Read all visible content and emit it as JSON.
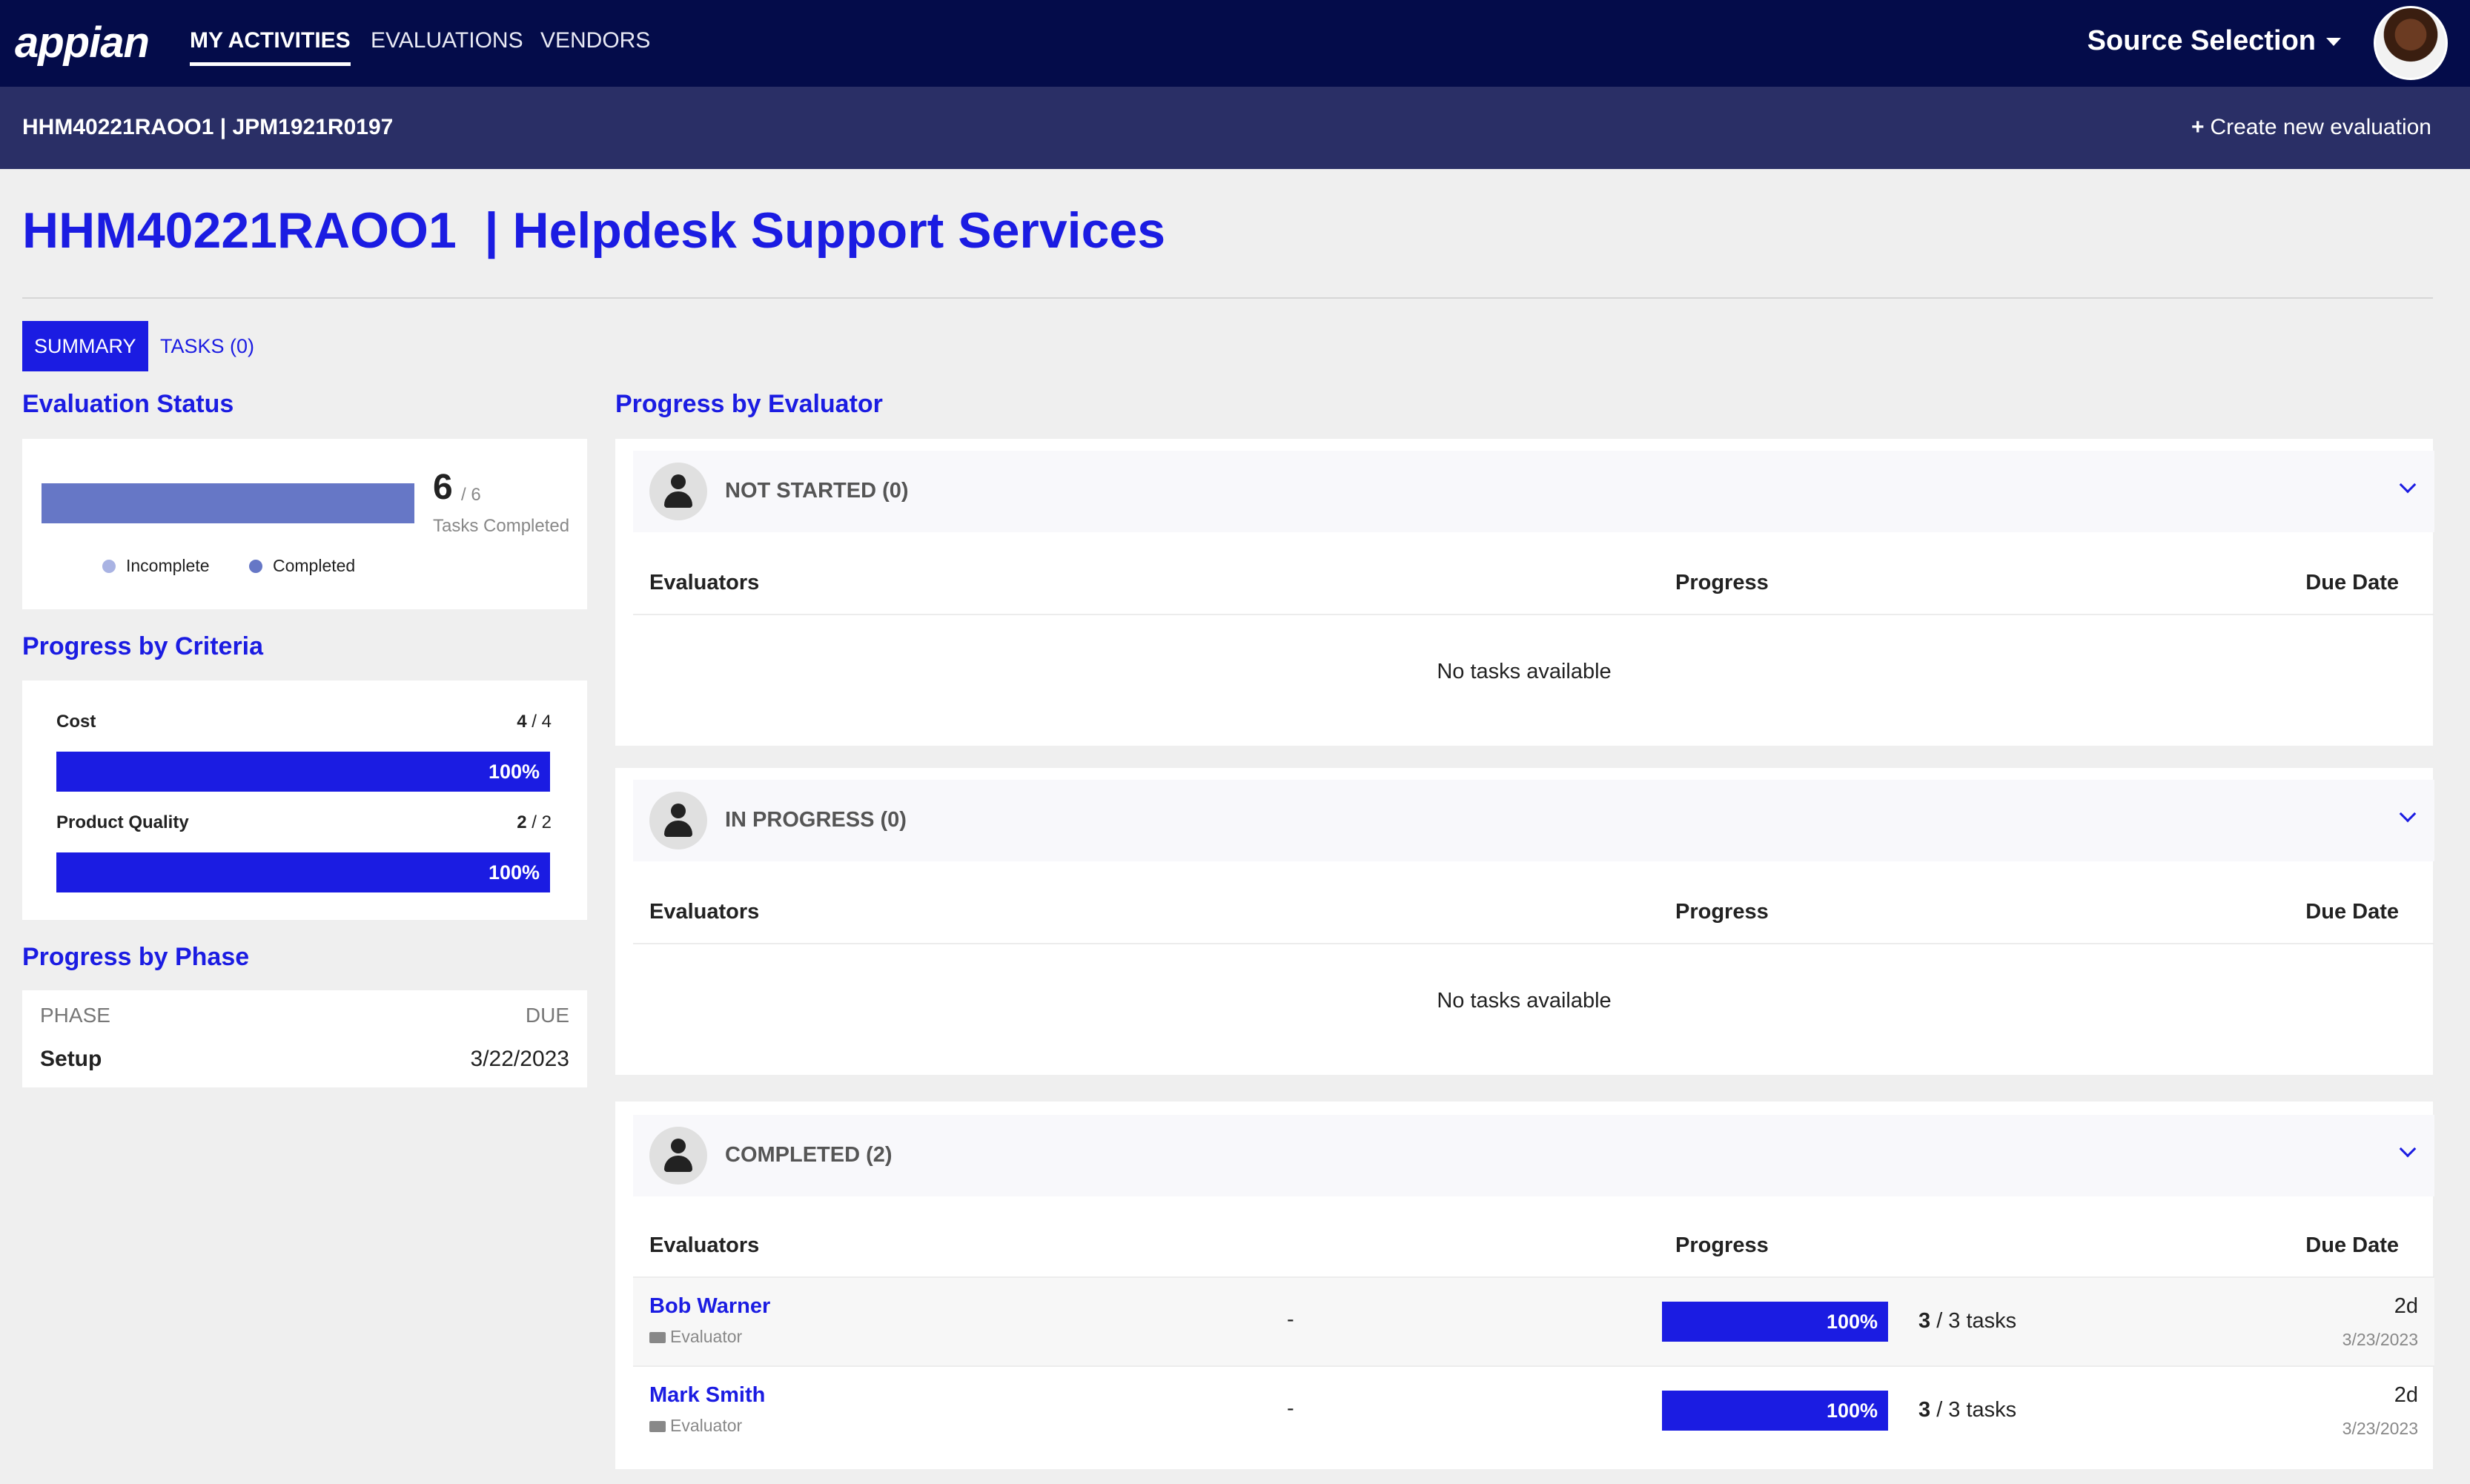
{
  "nav": {
    "logo": "appian",
    "links": [
      "MY ACTIVITIES",
      "EVALUATIONS",
      "VENDORS"
    ],
    "site": "Source Selection",
    "avatar_icon": "user-photo"
  },
  "subbar": {
    "crumb": "HHM40221RAOO1 | JPM1921R0197",
    "create": "Create new evaluation"
  },
  "page": {
    "title": "HHM40221RAOO1  | Helpdesk Support Services",
    "tabs": [
      "SUMMARY",
      "TASKS (0)"
    ]
  },
  "eval_status": {
    "title": "Evaluation Status",
    "completed": "6",
    "total": "/ 6",
    "caption": "Tasks Completed",
    "legend": [
      "Incomplete",
      "Completed"
    ],
    "colors": {
      "incomplete": "#a9b3e3",
      "completed": "#6677c6"
    }
  },
  "criteria": {
    "title": "Progress by Criteria",
    "items": [
      {
        "label": "Cost",
        "done": "4",
        "total": " / 4",
        "pct": "100%"
      },
      {
        "label": "Product Quality",
        "done": "2",
        "total": " / 2",
        "pct": "100%"
      }
    ]
  },
  "phase": {
    "title": "Progress by Phase",
    "col_phase": "PHASE",
    "col_due": "DUE",
    "rows": [
      {
        "phase": "Setup",
        "due": "3/22/2023"
      }
    ]
  },
  "evaluators": {
    "title": "Progress by Evaluator",
    "columns": [
      "Evaluators",
      "Progress",
      "Due Date"
    ],
    "empty": "No tasks available",
    "groups": [
      {
        "label": "NOT STARTED (0)"
      },
      {
        "label": "IN PROGRESS (0)"
      },
      {
        "label": "COMPLETED (2)"
      }
    ],
    "completed_rows": [
      {
        "name": "Bob Warner",
        "role": "Evaluator",
        "dash": "-",
        "pct": "100%",
        "done": "3",
        "of": " / 3 tasks",
        "due": "2d",
        "date": "3/23/2023"
      },
      {
        "name": "Mark Smith",
        "role": "Evaluator",
        "dash": "-",
        "pct": "100%",
        "done": "3",
        "of": " / 3 tasks",
        "due": "2d",
        "date": "3/23/2023"
      }
    ]
  },
  "accent": "#1b1ce2",
  "nav_bg": "#040c4a",
  "subbar_bg": "#2a2f66"
}
